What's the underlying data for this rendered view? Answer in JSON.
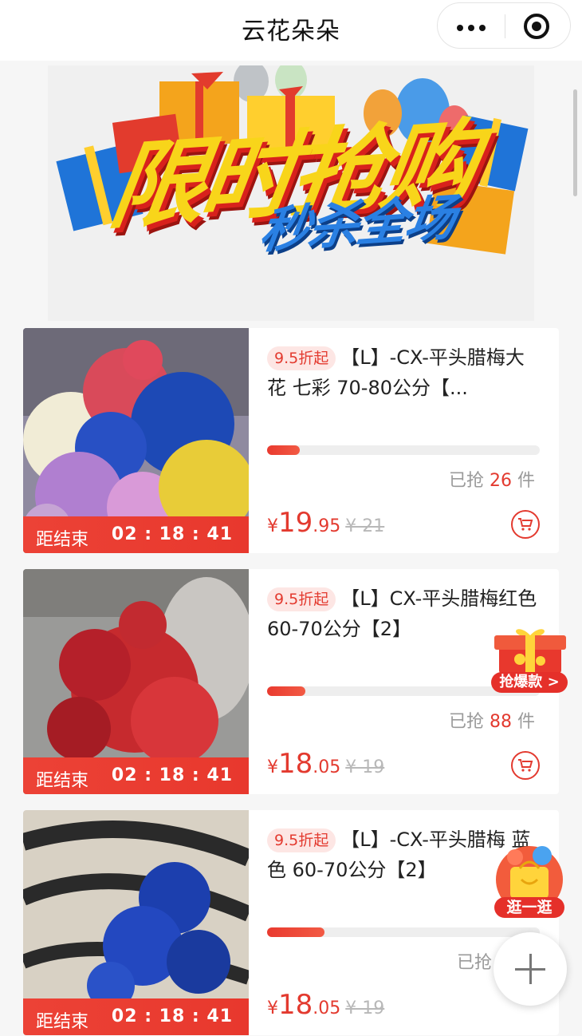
{
  "header": {
    "title": "云花朵朵"
  },
  "banner": {
    "headline": "限时抢购",
    "subline": "秒杀全场",
    "colors": {
      "headline": "#f8d51a",
      "subline": "#1f74d8",
      "shadow": "#d8211c"
    }
  },
  "products": [
    {
      "discount": "9.5折起",
      "title": "【L】-CX-平头腊梅大花 七彩 70-80公分【...",
      "progress": 0.12,
      "sold_prefix": "已抢",
      "sold_count": "26",
      "sold_unit": "件",
      "price_currency": "¥",
      "price_int": "19",
      "price_dec": ".95",
      "orig_price": "¥ 21",
      "countdown_label": "距结束",
      "countdown_time": "02 : 18 : 41",
      "image_theme": "mixed-color-waxflower"
    },
    {
      "discount": "9.5折起",
      "title": "【L】CX-平头腊梅红色 60-70公分【2】",
      "progress": 0.14,
      "sold_prefix": "已抢",
      "sold_count": "88",
      "sold_unit": "件",
      "price_currency": "¥",
      "price_int": "18",
      "price_dec": ".05",
      "orig_price": "¥ 19",
      "countdown_label": "距结束",
      "countdown_time": "02 : 18 : 41",
      "image_theme": "red-waxflower"
    },
    {
      "discount": "9.5折起",
      "title": "【L】-CX-平头腊梅 蓝色 60-70公分【2】",
      "progress": 0.21,
      "sold_prefix": "已抢",
      "sold_count": "",
      "sold_unit": "",
      "price_currency": "¥",
      "price_int": "18",
      "price_dec": ".05",
      "orig_price": "¥ 19",
      "countdown_label": "距结束",
      "countdown_time": "02 : 18 : 41",
      "image_theme": "blue-waxflower"
    }
  ],
  "floating": {
    "hot_label": "抢爆款 >",
    "shop_label": "逛一逛",
    "add_icon": "plus-icon"
  }
}
